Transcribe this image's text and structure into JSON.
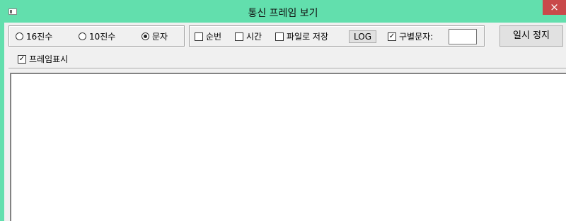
{
  "window": {
    "title": "통신 프레임 보기",
    "close_label": "×"
  },
  "radix": {
    "options": [
      {
        "label": "16진수",
        "selected": false
      },
      {
        "label": "10진수",
        "selected": false
      },
      {
        "label": "문자",
        "selected": true
      }
    ]
  },
  "options": {
    "sequence": {
      "label": "순번",
      "checked": false
    },
    "time": {
      "label": "시간",
      "checked": false
    },
    "save_file": {
      "label": "파일로 저장",
      "checked": false
    },
    "log_button": "LOG",
    "separator": {
      "label": "구별문자:",
      "checked": true,
      "value": ""
    }
  },
  "pause_button": "일시 정지",
  "frame_display": {
    "label": "프레임표시",
    "checked": true
  },
  "log_text": "",
  "colors": {
    "titlebar": "#62dfad",
    "close": "#c9494a",
    "panel": "#f0f0f0"
  }
}
